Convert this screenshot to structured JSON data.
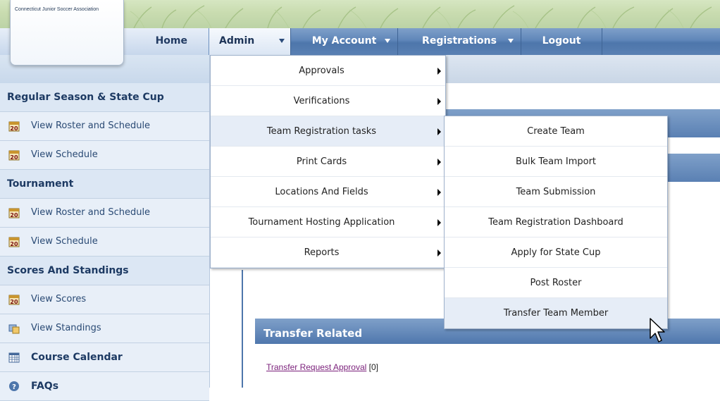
{
  "org": {
    "name": "Connecticut Junior Soccer Association"
  },
  "nav": {
    "home": "Home",
    "admin": "Admin",
    "my_account": "My Account",
    "registrations": "Registrations",
    "logout": "Logout"
  },
  "sidebar": {
    "sections": [
      {
        "heading": "Regular Season & State Cup",
        "items": [
          "View Roster and Schedule",
          "View Schedule"
        ]
      },
      {
        "heading": "Tournament",
        "items": [
          "View Roster and Schedule",
          "View Schedule"
        ]
      },
      {
        "heading": "Scores And Standings",
        "items": [
          "View Scores",
          "View Standings"
        ]
      }
    ],
    "course_calendar": "Course Calendar",
    "faqs": "FAQs",
    "calendar_icon_text": "20"
  },
  "admin_menu": [
    "Approvals",
    "Verifications",
    "Team Registration tasks",
    "Print Cards",
    "Locations And Fields",
    "Tournament Hosting Application",
    "Reports"
  ],
  "team_registration_submenu": [
    "Create Team",
    "Bulk Team Import",
    "Team Submission",
    "Team Registration Dashboard",
    "Apply for State Cup",
    "Post Roster",
    "Transfer Team Member"
  ],
  "content": {
    "section_title": "Transfer Related",
    "link_label": "Transfer Request Approval",
    "link_count": "[0]"
  },
  "colors": {
    "nav_blue": "#5a80b3",
    "sidebar_bg": "#dce7f4",
    "heading_text": "#1d3a63",
    "link_visited": "#7a1f7a"
  }
}
